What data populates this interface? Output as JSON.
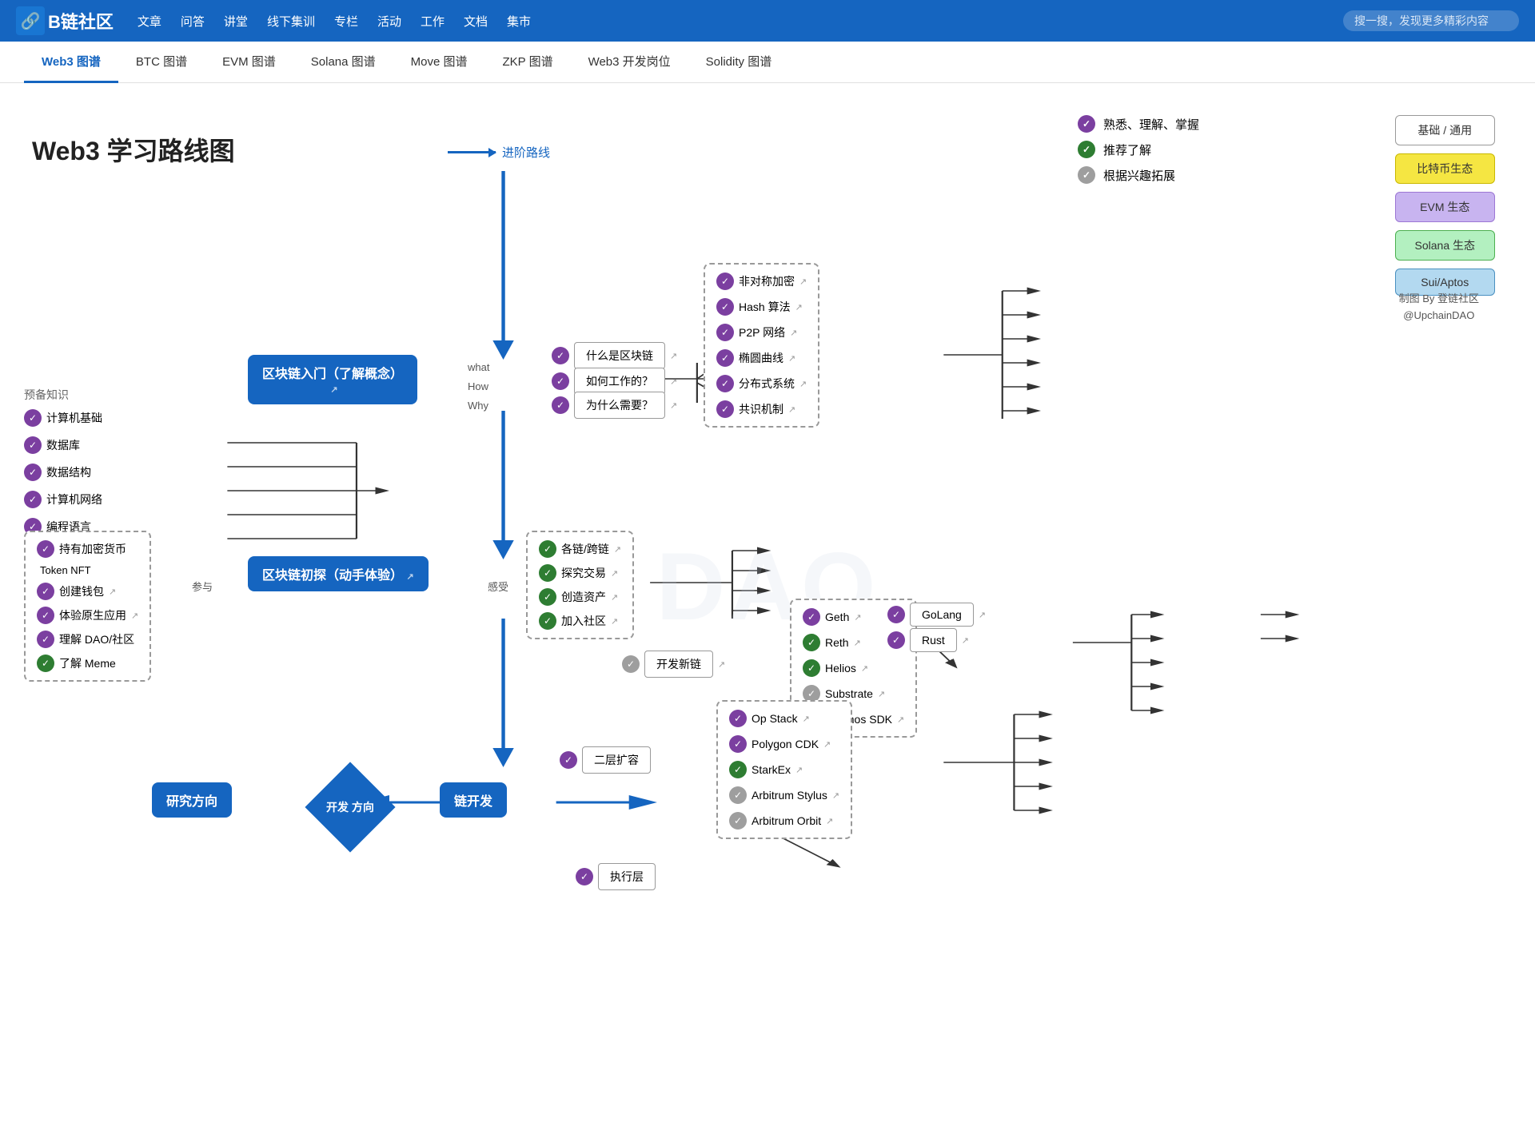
{
  "navbar": {
    "logo_text": "链社区",
    "logo_icon": "🔗",
    "nav_items": [
      "文章",
      "问答",
      "讲堂",
      "线下集训",
      "专栏",
      "活动",
      "工作",
      "文档",
      "集市"
    ],
    "search_placeholder": "搜一搜，发现更多精彩内容"
  },
  "tabbar": {
    "tabs": [
      {
        "label": "Web3 图谱",
        "active": true
      },
      {
        "label": "BTC 图谱"
      },
      {
        "label": "EVM 图谱"
      },
      {
        "label": "Solana 图谱"
      },
      {
        "label": "Move 图谱"
      },
      {
        "label": "ZKP 图谱"
      },
      {
        "label": "Web3 开发岗位"
      },
      {
        "label": "Solidity 图谱"
      }
    ]
  },
  "roadmap": {
    "title": "Web3 学习路线图",
    "advance_label": "进阶路线",
    "watermark": "DAO",
    "legend": [
      {
        "type": "purple",
        "text": "熟悉、理解、掌握"
      },
      {
        "type": "green",
        "text": "推荐了解"
      },
      {
        "type": "gray",
        "text": "根据兴趣拓展"
      }
    ],
    "categories": [
      {
        "label": "基础 / 通用",
        "style": "basic"
      },
      {
        "label": "比特币生态",
        "style": "bitcoin"
      },
      {
        "label": "EVM 生态",
        "style": "evm"
      },
      {
        "label": "Solana 生态",
        "style": "solana"
      },
      {
        "label": "Sui/Aptos",
        "style": "sui"
      }
    ],
    "author": "制图 By 登链社区\n@UpchainDAO",
    "prep_section": {
      "title": "预备知识",
      "items": [
        {
          "label": "计算机基础",
          "check": "purple"
        },
        {
          "label": "数据库",
          "check": "purple"
        },
        {
          "label": "数据结构",
          "check": "purple"
        },
        {
          "label": "计算机网络",
          "check": "purple"
        },
        {
          "label": "编程语言",
          "check": "purple"
        }
      ]
    },
    "main_nodes": {
      "intro": "区块链入门（了解概念）",
      "explore": "区块链初探（动手体验）",
      "direction_diamond": "开发\n方向",
      "research": "研究方向",
      "chain_dev": "链开发"
    },
    "intro_questions": [
      "什么是区块链",
      "如何工作的？",
      "为什么需要？"
    ],
    "intro_question_labels": [
      "what",
      "How",
      "Why"
    ],
    "intro_topics": [
      {
        "label": "非对称加密",
        "check": "purple"
      },
      {
        "label": "Hash 算法",
        "check": "purple"
      },
      {
        "label": "P2P 网络",
        "check": "purple"
      },
      {
        "label": "椭圆曲线",
        "check": "purple"
      },
      {
        "label": "分布式系统",
        "check": "purple"
      },
      {
        "label": "共识机制",
        "check": "purple"
      }
    ],
    "explore_left": {
      "title": "参与",
      "items_box": {
        "title": "",
        "items": [
          {
            "label": "持有加密货币",
            "check": "purple"
          },
          {
            "label": "Token  NFT"
          },
          {
            "label": "创建钱包",
            "check": "purple"
          },
          {
            "label": "体验原生应用",
            "check": "purple"
          },
          {
            "label": "理解 DAO/社区",
            "check": "purple"
          },
          {
            "label": "了解 Meme",
            "check": "green"
          }
        ]
      }
    },
    "explore_right": {
      "title": "感受",
      "items": [
        {
          "label": "各链/跨链",
          "check": "green"
        },
        {
          "label": "探究交易",
          "check": "green"
        },
        {
          "label": "创造资产",
          "check": "green"
        },
        {
          "label": "加入社区",
          "check": "green"
        }
      ]
    },
    "new_chain": {
      "label": "开发新链",
      "check": "gray",
      "items": [
        {
          "label": "Geth",
          "check": "purple"
        },
        {
          "label": "Reth",
          "check": "green"
        },
        {
          "label": "Helios",
          "check": "green"
        },
        {
          "label": "Substrate",
          "check": "gray"
        },
        {
          "label": "Cosmos SDK",
          "check": "gray"
        }
      ]
    },
    "chain_languages": [
      {
        "label": "GoLang",
        "check": "purple"
      },
      {
        "label": "Rust",
        "check": "purple"
      }
    ],
    "l2": {
      "label": "二层扩容",
      "check": "purple",
      "items": [
        {
          "label": "Op Stack",
          "check": "purple"
        },
        {
          "label": "Polygon CDK",
          "check": "purple"
        },
        {
          "label": "StarkEx",
          "check": "green"
        },
        {
          "label": "Arbitrum Stylus",
          "check": "gray"
        },
        {
          "label": "Arbitrum Orbit",
          "check": "gray"
        }
      ]
    },
    "execution_layer": {
      "label": "执行层",
      "check": "purple"
    }
  }
}
